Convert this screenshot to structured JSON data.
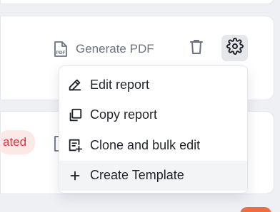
{
  "report_card": {
    "generate_pdf_label": "Generate PDF",
    "pdf_icon": "pdf-file-icon",
    "delete_icon": "trash-icon",
    "settings_icon": "gear-icon"
  },
  "second_card": {
    "status_badge": "ated"
  },
  "context_menu": {
    "items": [
      {
        "label": "Edit report",
        "icon": "pencil-icon"
      },
      {
        "label": "Copy report",
        "icon": "copy-icon"
      },
      {
        "label": "Clone and bulk edit",
        "icon": "clone-edit-icon"
      },
      {
        "label": "Create Template",
        "icon": "plus-icon"
      }
    ]
  },
  "colors": {
    "badge_background": "#fde8e8",
    "badge_text": "#d9353f",
    "menu_hover": "#f3f4f6",
    "accent_orange": "#f36b3c"
  }
}
